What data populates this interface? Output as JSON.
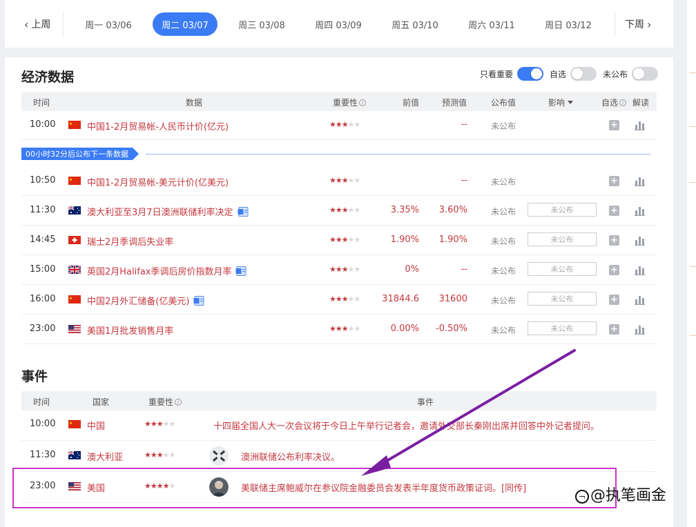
{
  "week": {
    "prev": "上周",
    "next": "下周",
    "days": [
      {
        "label": "周一 03/06",
        "active": false
      },
      {
        "label": "周二 03/07",
        "active": true
      },
      {
        "label": "周三 03/08",
        "active": false
      },
      {
        "label": "周四 03/09",
        "active": false
      },
      {
        "label": "周五 03/10",
        "active": false
      },
      {
        "label": "周六 03/11",
        "active": false
      },
      {
        "label": "周日 03/12",
        "active": false
      }
    ]
  },
  "econ": {
    "title": "经济数据",
    "toggles": [
      {
        "label": "只看重要",
        "on": true
      },
      {
        "label": "自选",
        "on": false
      },
      {
        "label": "未公布",
        "on": false
      }
    ],
    "headers": {
      "time": "时间",
      "data": "数据",
      "importance": "重要性",
      "prev": "前值",
      "forecast": "预测值",
      "actual": "公布值",
      "impact": "影响",
      "fav": "自选",
      "explain": "解读"
    },
    "countdown": "00小时32分后公布下一条数据",
    "rows": [
      {
        "time": "10:00",
        "flag": "cn",
        "name": "中国1-2月贸易帐-人民币计价(亿元)",
        "stars": 3,
        "prev": "",
        "forecast": "--",
        "actual": "未公布",
        "impact": "",
        "doc": false
      },
      {
        "time": "10:50",
        "flag": "cn",
        "name": "中国1-2月贸易帐-美元计价(亿美元)",
        "stars": 3,
        "prev": "",
        "forecast": "--",
        "actual": "未公布",
        "impact": "",
        "doc": false
      },
      {
        "time": "11:30",
        "flag": "au",
        "name": "澳大利亚至3月7日澳洲联储利率决定",
        "stars": 3,
        "prev": "3.35%",
        "forecast": "3.60%",
        "actual": "未公布",
        "impact": "未公布",
        "doc": true
      },
      {
        "time": "14:45",
        "flag": "ch",
        "name": "瑞士2月季调后失业率",
        "stars": 3,
        "prev": "1.90%",
        "forecast": "1.90%",
        "actual": "未公布",
        "impact": "未公布",
        "doc": false
      },
      {
        "time": "15:00",
        "flag": "gb",
        "name": "英国2月Halifax季调后房价指数月率",
        "stars": 3,
        "prev": "0%",
        "forecast": "--",
        "actual": "未公布",
        "impact": "未公布",
        "doc": true
      },
      {
        "time": "16:00",
        "flag": "cn",
        "name": "中国2月外汇储备(亿美元)",
        "stars": 3,
        "prev": "31844.6",
        "forecast": "31600",
        "actual": "未公布",
        "impact": "未公布",
        "doc": true
      },
      {
        "time": "23:00",
        "flag": "us",
        "name": "美国1月批发销售月率",
        "stars": 3,
        "prev": "0.00%",
        "forecast": "-0.50%",
        "actual": "未公布",
        "impact": "未公布",
        "doc": false
      }
    ]
  },
  "events": {
    "title": "事件",
    "headers": {
      "time": "时间",
      "country": "国家",
      "importance": "重要性",
      "event": "事件"
    },
    "rows": [
      {
        "time": "10:00",
        "flag": "cn",
        "country": "中国",
        "stars": 3,
        "avatar": "",
        "text": "十四届全国人大一次会议将于今日上午举行记者会，邀请外交部长秦刚出席并回答中外记者提问。"
      },
      {
        "time": "11:30",
        "flag": "au",
        "country": "澳大利亚",
        "stars": 3,
        "avatar": "rba-logo",
        "text": "澳洲联储公布利率决议。"
      },
      {
        "time": "23:00",
        "flag": "us",
        "country": "美国",
        "stars": 4,
        "avatar": "person-photo",
        "text": "美联储主席鲍威尔在参议院金融委员会发表半年度货币政策证词。[同传]"
      }
    ]
  },
  "watermark": "@执笔画金",
  "colors": {
    "accent": "#3b7cf5",
    "data_red": "#c4393f",
    "annotation": "#cc33cc",
    "arrow": "#7a1fa2"
  }
}
